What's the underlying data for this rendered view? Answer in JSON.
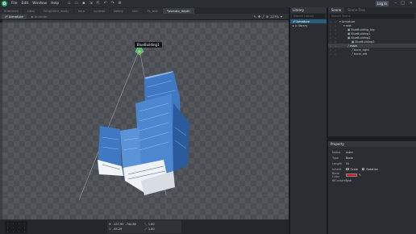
{
  "menu": {
    "logo": "D",
    "items": [
      "File",
      "Edit",
      "Window",
      "Help"
    ],
    "login_label": "Log In",
    "window_controls": [
      "–",
      "□",
      "✕"
    ]
  },
  "doc_tabs": [
    {
      "label": "Shenmen",
      "active": false
    },
    {
      "label": "Ubbi",
      "active": false
    },
    {
      "label": "Tsing2000_ready",
      "active": false
    },
    {
      "label": "hero",
      "active": false
    },
    {
      "label": "syntest",
      "active": false
    },
    {
      "label": "Nekoy",
      "active": false
    },
    {
      "label": "skin",
      "active": false
    },
    {
      "label": "Ps_test",
      "active": false
    },
    {
      "label": "*pseudo_depth",
      "active": true
    }
  ],
  "viewport": {
    "tabs": [
      {
        "label": "Armature",
        "active": true
      },
      {
        "label": "Animate",
        "active": false
      }
    ],
    "zoom": "227%",
    "tooltip": "BlueBuilding1"
  },
  "coords": {
    "x": "-137.99",
    "y": "-744.60",
    "rot": "-93.29",
    "sx": "1.00",
    "sy": "1.00"
  },
  "library": {
    "title": "Library",
    "search_placeholder": "Search Library",
    "items": [
      {
        "label": "Armature",
        "selected": true
      },
      {
        "label": "library",
        "selected": false
      }
    ]
  },
  "scene": {
    "tabs": [
      {
        "label": "Scene",
        "active": true
      },
      {
        "label": "Scene Tree",
        "active": false
      }
    ],
    "search_placeholder": "Search Scene",
    "tree": [
      {
        "label": "Armature",
        "indent": 0,
        "icon": "▾",
        "selected": false
      },
      {
        "label": "root",
        "indent": 1,
        "icon": "▾",
        "selected": false
      },
      {
        "label": "BlueBuilding_big",
        "indent": 2,
        "icon": "▣",
        "selected": false
      },
      {
        "label": "BlueBuilding1",
        "indent": 2,
        "icon": "▣",
        "selected": false
      },
      {
        "label": "BlueBuilding2",
        "indent": 2,
        "icon": "▣",
        "selected": false
      },
      {
        "label": "BlueBuilding3",
        "indent": 3,
        "icon": "▣",
        "selected": false
      },
      {
        "label": "main",
        "indent": 2,
        "icon": "╱",
        "selected": true
      },
      {
        "label": "bone_right",
        "indent": 3,
        "icon": "╱",
        "selected": false
      },
      {
        "label": "bone_left",
        "indent": 3,
        "icon": "╱",
        "selected": false
      }
    ]
  },
  "property": {
    "title": "Property",
    "rows": [
      {
        "key": "Name",
        "value": "main"
      },
      {
        "key": "Type",
        "value": "Bone"
      },
      {
        "key": "Length",
        "value": "51"
      }
    ],
    "inherit_label": "Inherit",
    "scale_label": "Scale",
    "rotation_label": "Rotation",
    "bone_color_label": "Bone Color",
    "bone_color": "#e01010",
    "ikconstraint_label": "IKConstraint"
  },
  "colors": {
    "accent": "#2fb36b",
    "selection": "#2a5d78",
    "building_blue": "#3f79c4"
  }
}
